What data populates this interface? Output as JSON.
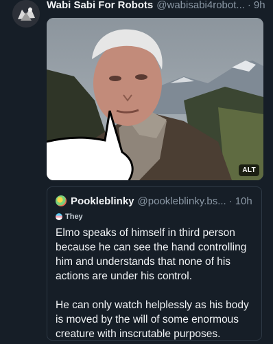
{
  "post": {
    "display_name": "Wabi Sabi For Robots",
    "handle": "@wabisabi4robot...",
    "separator": "·",
    "time": "9h",
    "image_badge": "ALT"
  },
  "quote": {
    "display_name": "Pookleblinky",
    "handle": "@pookleblinky.bs...",
    "separator": "·",
    "time": "10h",
    "label": "They",
    "text": "Elmo speaks of himself in third person because he can see the hand controlling him and understands that none of his actions are under his control.\n\nHe can only watch helplessly as his body is moved by the will of some enormous creature with inscrutable purposes."
  }
}
